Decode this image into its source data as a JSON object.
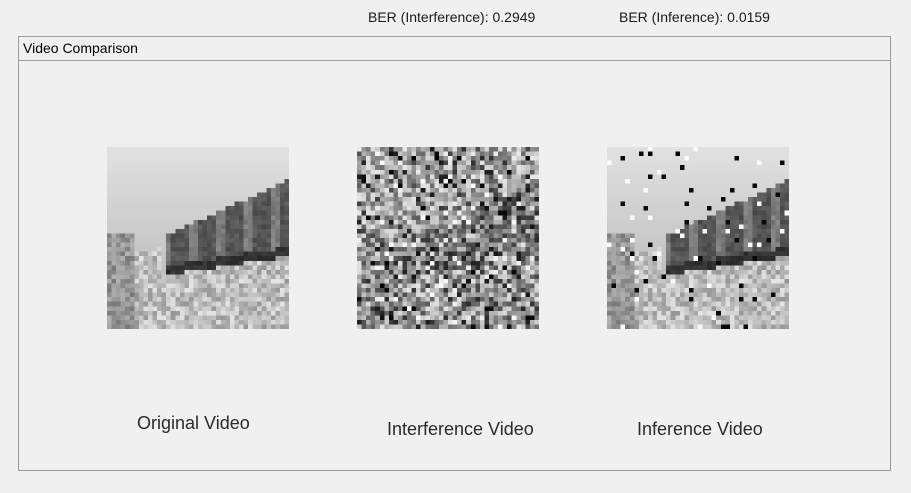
{
  "status": {
    "ber_interference": "BER (Interference): 0.2949",
    "ber_inference": "BER (Inference): 0.0159"
  },
  "panel": {
    "title": "Video Comparison"
  },
  "videos": [
    {
      "caption": "Original Video"
    },
    {
      "caption": "Interference Video"
    },
    {
      "caption": "Inference Video"
    }
  ]
}
